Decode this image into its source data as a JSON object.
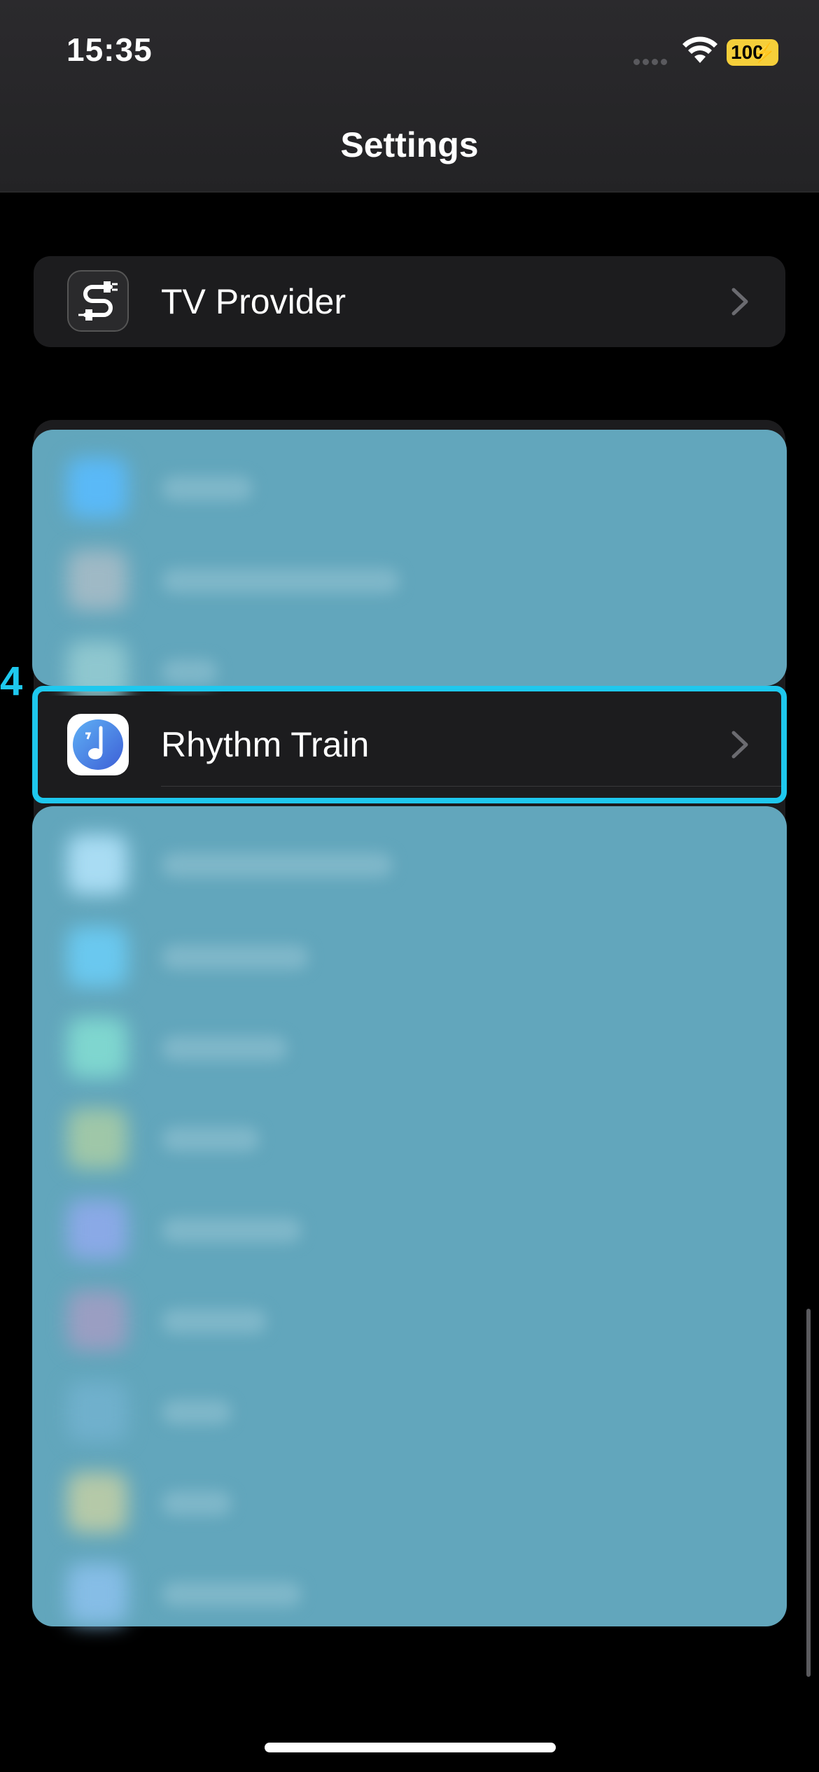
{
  "status_bar": {
    "time": "15:35",
    "battery": "100"
  },
  "header": {
    "title": "Settings"
  },
  "groups": {
    "tv": {
      "label": "TV Provider",
      "icon": "cable-connector-icon"
    },
    "apps": {
      "highlighted": {
        "label": "Rhythm Train",
        "icon": "music-note-icon",
        "marker": "4"
      }
    }
  },
  "colors": {
    "highlight": "#1ec8ee",
    "overlay": "#62a6bc",
    "battery": "#f5cf3a"
  }
}
